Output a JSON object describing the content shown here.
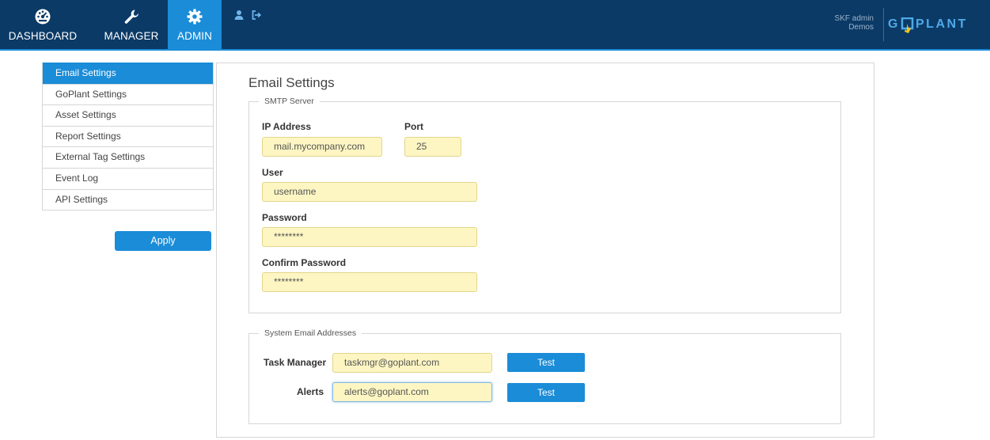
{
  "nav": {
    "tabs": [
      {
        "label": "DASHBOARD",
        "icon": "dashboard-icon"
      },
      {
        "label": "MANAGER",
        "icon": "wrench-icon"
      },
      {
        "label": "ADMIN",
        "icon": "gear-icon",
        "active": true
      }
    ],
    "user_name": "SKF admin",
    "user_org": "Demos",
    "logo_text": "GOPLANT"
  },
  "sidebar": {
    "items": [
      {
        "label": "Email Settings",
        "active": true
      },
      {
        "label": "GoPlant Settings"
      },
      {
        "label": "Asset Settings"
      },
      {
        "label": "Report Settings"
      },
      {
        "label": "External Tag Settings"
      },
      {
        "label": "Event Log"
      },
      {
        "label": "API Settings"
      }
    ],
    "apply_label": "Apply"
  },
  "main": {
    "title": "Email Settings",
    "smtp": {
      "legend": "SMTP Server",
      "ip_label": "IP Address",
      "ip_value": "mail.mycompany.com",
      "port_label": "Port",
      "port_value": "25",
      "user_label": "User",
      "user_value": "username",
      "password_label": "Password",
      "password_value": "********",
      "confirm_label": "Confirm Password",
      "confirm_value": "********"
    },
    "system": {
      "legend": "System Email Addresses",
      "task_label": "Task Manager",
      "task_value": "taskmgr@goplant.com",
      "alerts_label": "Alerts",
      "alerts_value": "alerts@goplant.com",
      "test_label": "Test"
    }
  },
  "colors": {
    "topbar": "#0b3a66",
    "accent": "#1a8cd8",
    "input_bg": "#fdf6c3"
  }
}
